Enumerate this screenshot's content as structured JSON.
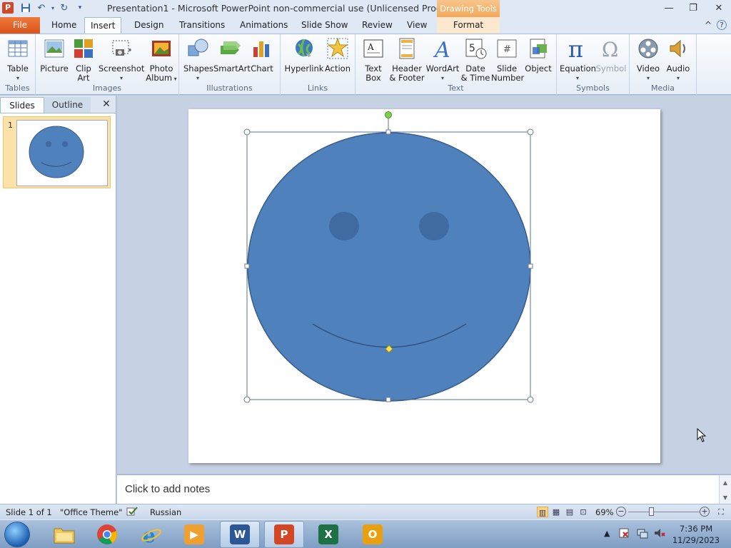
{
  "window": {
    "title": "Presentation1  -  Microsoft PowerPoint non-commercial use (Unlicensed Product)",
    "context_tab": "Drawing Tools"
  },
  "ribbon_tabs": [
    "Home",
    "Insert",
    "Design",
    "Transitions",
    "Animations",
    "Slide Show",
    "Review",
    "View",
    "Format"
  ],
  "file_tab": "File",
  "active_tab": "Insert",
  "groups": {
    "tables": {
      "label": "Tables",
      "buttons": [
        {
          "label": "Table",
          "icon": "table-icon"
        }
      ]
    },
    "images": {
      "label": "Images",
      "buttons": [
        {
          "label": "Picture",
          "icon": "picture-icon"
        },
        {
          "label1": "Clip",
          "label2": "Art",
          "icon": "clip-art-icon"
        },
        {
          "label": "Screenshot",
          "icon": "screenshot-icon"
        },
        {
          "label1": "Photo",
          "label2": "Album",
          "icon": "photo-album-icon"
        }
      ]
    },
    "illustrations": {
      "label": "Illustrations",
      "buttons": [
        {
          "label": "Shapes",
          "icon": "shapes-icon"
        },
        {
          "label": "SmartArt",
          "icon": "smartart-icon"
        },
        {
          "label": "Chart",
          "icon": "chart-icon"
        }
      ]
    },
    "links": {
      "label": "Links",
      "buttons": [
        {
          "label": "Hyperlink",
          "icon": "hyperlink-icon"
        },
        {
          "label": "Action",
          "icon": "action-icon"
        }
      ]
    },
    "text": {
      "label": "Text",
      "buttons": [
        {
          "label1": "Text",
          "label2": "Box",
          "icon": "text-box-icon"
        },
        {
          "label1": "Header",
          "label2": "& Footer",
          "icon": "header-footer-icon"
        },
        {
          "label": "WordArt",
          "icon": "wordart-icon"
        },
        {
          "label1": "Date",
          "label2": "& Time",
          "icon": "date-time-icon"
        },
        {
          "label1": "Slide",
          "label2": "Number",
          "icon": "slide-number-icon"
        },
        {
          "label": "Object",
          "icon": "object-icon"
        }
      ]
    },
    "symbols": {
      "label": "Symbols",
      "buttons": [
        {
          "label": "Equation",
          "icon": "equation-icon"
        },
        {
          "label": "Symbol",
          "icon": "symbol-icon"
        }
      ]
    },
    "media": {
      "label": "Media",
      "buttons": [
        {
          "label": "Video",
          "icon": "video-icon"
        },
        {
          "label": "Audio",
          "icon": "audio-icon"
        }
      ]
    }
  },
  "left_pane": {
    "tabs": [
      "Slides",
      "Outline"
    ],
    "active": "Slides",
    "slides": [
      {
        "number": "1"
      }
    ]
  },
  "notes": {
    "placeholder": "Click to add notes"
  },
  "status_bar": {
    "slide": "Slide 1 of 1",
    "theme": "\"Office Theme\"",
    "language": "Russian",
    "zoom": "69%"
  },
  "taskbar": {
    "apps": [
      "file-explorer",
      "chrome",
      "internet-explorer",
      "media-player",
      "word",
      "powerpoint",
      "excel",
      "outlook"
    ],
    "active": "powerpoint",
    "time": "7:36 PM",
    "date": "11/29/2023"
  },
  "colors": {
    "shape_fill": "#4f81bd",
    "shape_stroke": "#385d8a",
    "eyes": "#3f6aa2",
    "file_tab": "#d9531a",
    "context_tab": "#f2a95c"
  }
}
